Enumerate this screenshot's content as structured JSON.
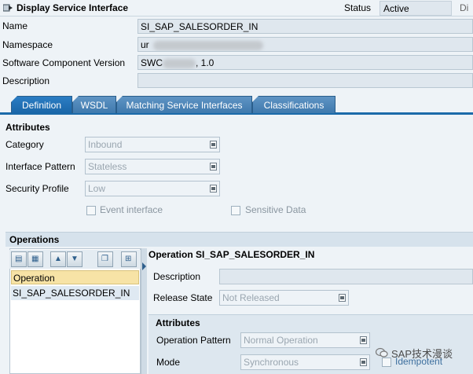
{
  "header": {
    "title": "Display Service Interface",
    "status_label": "Status",
    "status_value": "Active",
    "di_label": "Di"
  },
  "fields": {
    "name_label": "Name",
    "name_value": "SI_SAP_SALESORDER_IN",
    "namespace_label": "Namespace",
    "namespace_value": "ur",
    "scv_label": "Software Component Version",
    "scv_value_prefix": "SWC",
    "scv_value_suffix": ", 1.0",
    "description_label": "Description",
    "description_value": ""
  },
  "tabs": [
    {
      "label": "Definition",
      "active": true
    },
    {
      "label": "WSDL",
      "active": false
    },
    {
      "label": "Matching Service Interfaces",
      "active": false
    },
    {
      "label": "Classifications",
      "active": false
    }
  ],
  "attributes": {
    "title": "Attributes",
    "category_label": "Category",
    "category_value": "Inbound",
    "pattern_label": "Interface Pattern",
    "pattern_value": "Stateless",
    "security_label": "Security Profile",
    "security_value": "Low",
    "event_label": "Event interface",
    "sensitive_label": "Sensitive Data"
  },
  "operations": {
    "title": "Operations",
    "column_header": "Operation",
    "rows": [
      "SI_SAP_SALESORDER_IN"
    ],
    "detail_title": "Operation SI_SAP_SALESORDER_IN",
    "description_label": "Description",
    "release_label": "Release State",
    "release_value": "Not Released",
    "attributes_title": "Attributes",
    "op_pattern_label": "Operation Pattern",
    "op_pattern_value": "Normal Operation",
    "mode_label": "Mode",
    "mode_value": "Synchronous",
    "idempotent_label": "Idempotent"
  },
  "watermark": "SAP技术漫谈",
  "colors": {
    "tab_active": "#1a66a8",
    "tab_inactive": "#3f79ad",
    "column_header_bg": "#f7e3a6",
    "background": "#eef3f7"
  }
}
